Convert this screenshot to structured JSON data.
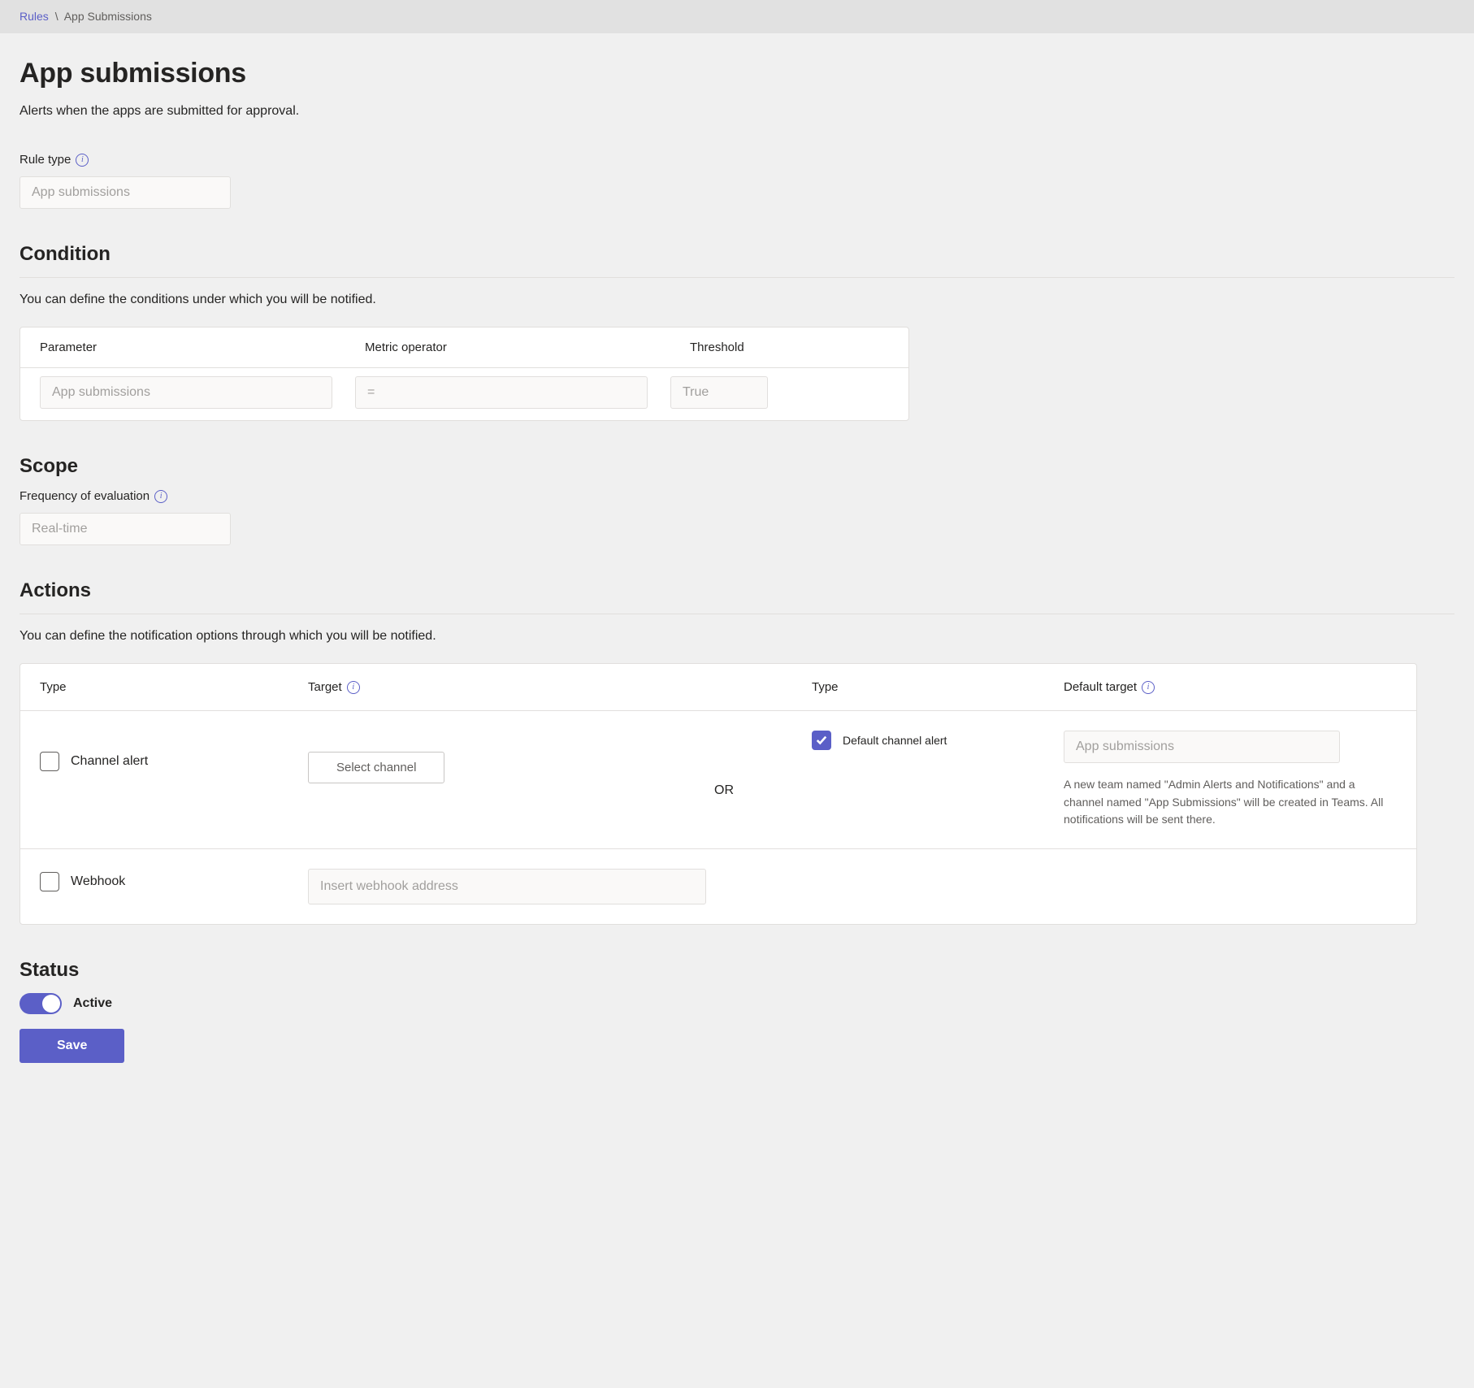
{
  "breadcrumb": {
    "parent": "Rules",
    "separator": "\\",
    "current": "App Submissions"
  },
  "page": {
    "title": "App submissions",
    "description": "Alerts when the apps are submitted for approval."
  },
  "rule_type": {
    "label": "Rule type",
    "value": "App submissions"
  },
  "condition": {
    "heading": "Condition",
    "description": "You can define the conditions under which you will be notified.",
    "columns": {
      "parameter": "Parameter",
      "metric_operator": "Metric operator",
      "threshold": "Threshold"
    },
    "row": {
      "parameter": "App submissions",
      "operator": "=",
      "threshold": "True"
    }
  },
  "scope": {
    "heading": "Scope",
    "frequency_label": "Frequency of evaluation",
    "frequency_value": "Real-time"
  },
  "actions": {
    "heading": "Actions",
    "description": "You can define the notification options through which you will be notified.",
    "columns": {
      "type_left": "Type",
      "target": "Target",
      "type_right": "Type",
      "default_target": "Default target"
    },
    "channel_alert": {
      "label": "Channel alert",
      "button": "Select channel",
      "or": "OR"
    },
    "default_channel": {
      "label": "Default channel alert",
      "target_value": "App submissions",
      "description": "A new team named \"Admin Alerts and Notifications\" and a channel named \"App Submissions\" will be created in Teams. All notifications will be sent there."
    },
    "webhook": {
      "label": "Webhook",
      "placeholder": "Insert webhook address"
    }
  },
  "status": {
    "heading": "Status",
    "label": "Active",
    "save_button": "Save"
  }
}
